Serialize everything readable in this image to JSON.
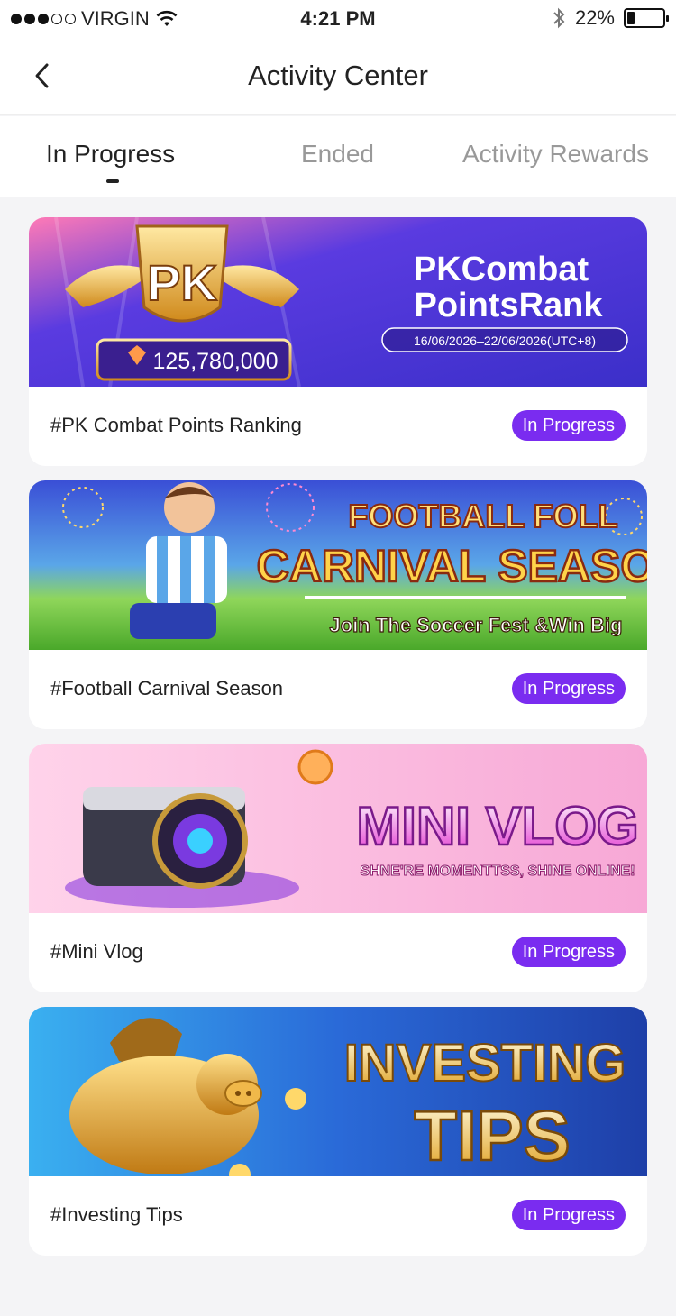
{
  "status_bar": {
    "carrier": "VIRGIN",
    "time": "4:21 PM",
    "battery": "22%"
  },
  "nav": {
    "title": "Activity Center"
  },
  "tabs": [
    {
      "label": "In Progress"
    },
    {
      "label": "Ended"
    },
    {
      "label": "Activity Rewards"
    }
  ],
  "activities": [
    {
      "title": "#PK Combat Points Ranking",
      "status": "In Progress",
      "banner": {
        "line1": "PKCombat",
        "line2": "PointsRank",
        "dates": "16/06/2026–22/06/2026(UTC+8)",
        "trophy_label": "PK",
        "points": "125,780,000"
      }
    },
    {
      "title": "#Football Carnival Season",
      "status": "In Progress",
      "banner": {
        "line1": "FOOTBALL FOLL",
        "line2": "CARNIVAL SEASON",
        "tagline": "Join The Soccer Fest  &Win Big"
      }
    },
    {
      "title": "#Mini Vlog",
      "status": "In Progress",
      "banner": {
        "line1": "MINI VLOG",
        "tagline": "SHNE'RE MOMENTTSS, SHINE ONLINE!"
      }
    },
    {
      "title": "#Investing Tips",
      "status": "In Progress",
      "banner": {
        "line1": "INVESTING",
        "line2": "TIPS"
      }
    }
  ],
  "colors": {
    "accent": "#7a2cf0",
    "background": "#f4f4f6"
  }
}
